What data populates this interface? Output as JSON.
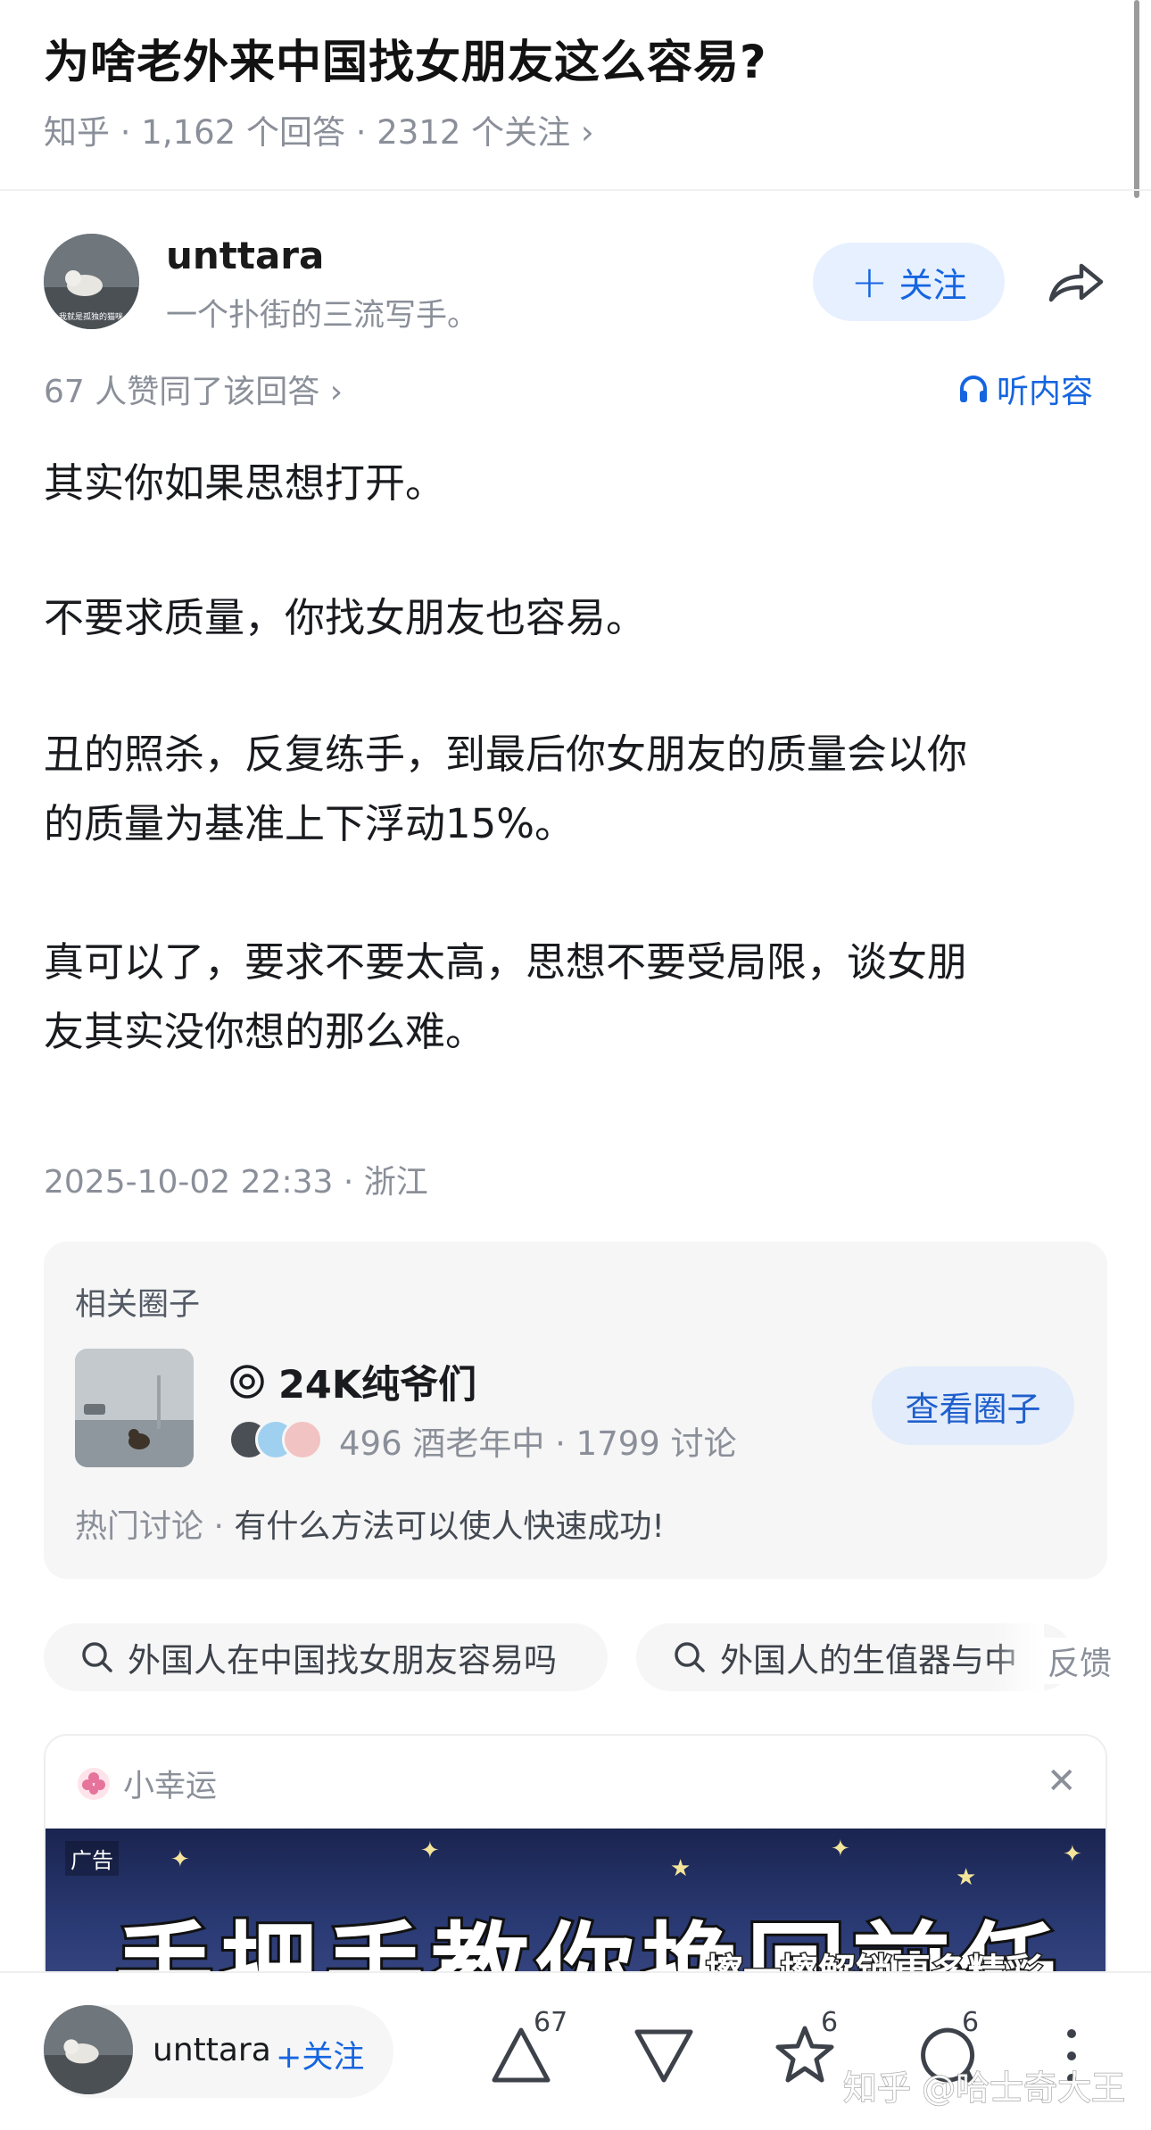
{
  "question": {
    "title": "为啥老外来中国找女朋友这么容易?",
    "meta": "知乎 · 1,162 个回答 · 2312 个关注 ›"
  },
  "author": {
    "name": "unttara",
    "bio": "一个扑街的三流写手。",
    "follow_label": "关注",
    "avatar_caption": "我就是孤独的猫咪"
  },
  "answer": {
    "votes_text": "67 人赞同了该回答 ›",
    "listen_label": "听内容",
    "lines": [
      "其实你如果思想打开。",
      "不要求质量，你找女朋友也容易。",
      "丑的照杀，反复练手，到最后你女朋友的质量会以你",
      "的质量为基准上下浮动15%。",
      "真可以了，要求不要太高，思想不要受局限，谈女朋",
      "友其实没你想的那么难。"
    ],
    "date_location": "2025-10-02 22:33 · 浙江"
  },
  "circle": {
    "section_title": "相关圈子",
    "name": "24K纯爷们",
    "stats": "496 酒老年中 · 1799 讨论",
    "view_button": "查看圈子",
    "hot_label": "热门讨论 · ",
    "hot_topic": "有什么方法可以使人快速成功!"
  },
  "related_searches": [
    "外国人在中国找女朋友容易吗",
    "外国人的生值器与中"
  ],
  "feedback_label": "反馈",
  "ad": {
    "brand": "小幸运",
    "tag": "广告",
    "headline": "手把手教你挽回前任",
    "sub": "擦一擦解锁更多精彩"
  },
  "bottom_bar": {
    "author_name": "unttara",
    "follow_label": "+关注",
    "upvote_count": "67",
    "favorite_count": "6",
    "comment_count": "6",
    "watermark": "知乎 @哈士奇大王"
  },
  "colors": {
    "accent_blue": "#1565e0",
    "follow_bg": "#e7f0ff",
    "muted_text": "#8a8f99",
    "card_bg": "#f6f6f6"
  }
}
